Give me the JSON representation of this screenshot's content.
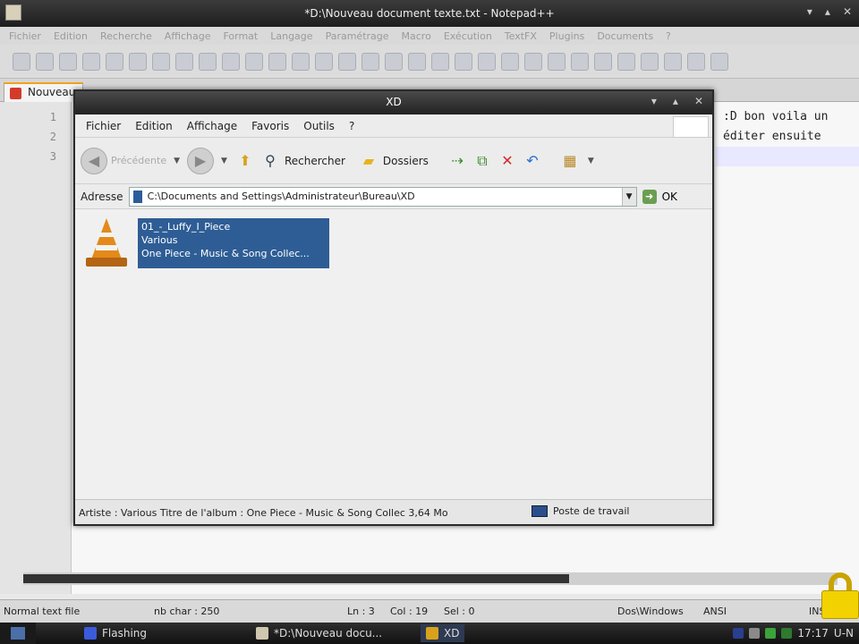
{
  "notepad": {
    "title": "*D:\\Nouveau document texte.txt - Notepad++",
    "menu": [
      "Fichier",
      "Edition",
      "Recherche",
      "Affichage",
      "Format",
      "Langage",
      "Paramétrage",
      "Macro",
      "Exécution",
      "TextFX",
      "Plugins",
      "Documents",
      "?"
    ],
    "tab_label": "Nouveau",
    "line_numbers": [
      "1",
      "2",
      "3"
    ],
    "text_lines": [
      ":D bon voila un",
      "éditer ensuite",
      ""
    ],
    "status": {
      "file_type": "Normal text file",
      "nb_char": "nb char : 250",
      "ln": "Ln : 3",
      "col": "Col : 19",
      "sel": "Sel : 0",
      "eol": "Dos\\Windows",
      "encoding": "ANSI",
      "mode": "INS"
    }
  },
  "explorer": {
    "title": "XD",
    "menu": [
      "Fichier",
      "Edition",
      "Affichage",
      "Favoris",
      "Outils",
      "?"
    ],
    "toolbar": {
      "back": "Précédente",
      "search": "Rechercher",
      "folders": "Dossiers"
    },
    "address": {
      "label": "Adresse",
      "path": "C:\\Documents and Settings\\Administrateur\\Bureau\\XD",
      "go": "OK"
    },
    "file": {
      "line1": "01_-_Luffy_I_Piece",
      "line2": "Various",
      "line3": "One Piece - Music & Song Collec..."
    },
    "status": {
      "info": "Artiste : Various Titre de l'album : One Piece - Music & Song Collec 3,64 Mo",
      "zone": "Poste de travail"
    }
  },
  "taskbar": {
    "tasks": [
      "Flashing",
      "*D:\\Nouveau docu...",
      "XD"
    ],
    "clock": "17:17",
    "lang": "U-N"
  },
  "colors": {
    "selection": "#2e5d95",
    "lock": "#f2d200",
    "tab_accent": "#f2a11d"
  }
}
